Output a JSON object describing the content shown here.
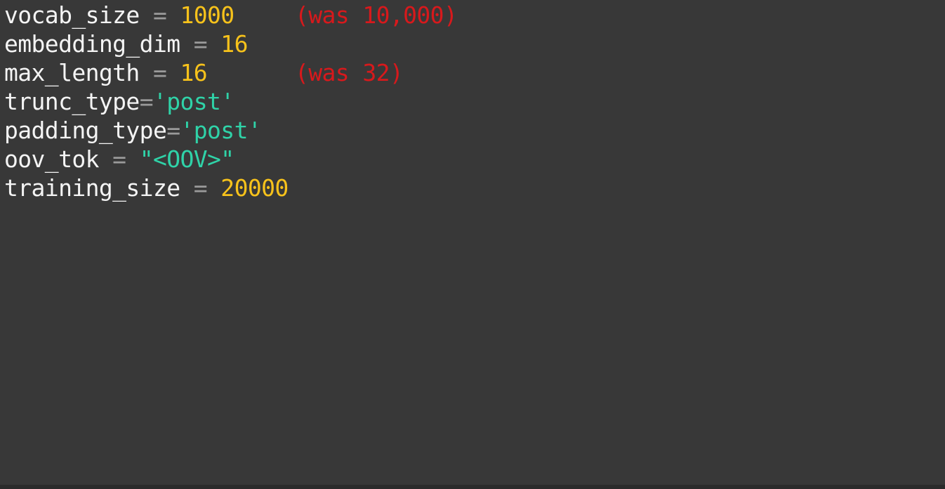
{
  "colors": {
    "background": "#383838",
    "identifier": "#f4f4f4",
    "operator": "#9a9a9a",
    "number": "#f7c21b",
    "string": "#2fd3a8",
    "annotation": "#d7191c"
  },
  "code_lines": [
    {
      "name": "vocab_size",
      "operator": " = ",
      "value": "1000",
      "annotation": "(was 10,000)"
    },
    {
      "name": "embedding_dim",
      "operator": " = ",
      "value": "16"
    },
    {
      "name": "max_length",
      "operator": " = ",
      "value": "16",
      "annotation": "(was 32)"
    },
    {
      "name": "trunc_type",
      "operator": "=",
      "value": "'post'"
    },
    {
      "name": "padding_type",
      "operator": "=",
      "value": "'post'"
    },
    {
      "name": "oov_tok",
      "operator": " = ",
      "value": "\"<OOV>\""
    },
    {
      "name": "training_size",
      "operator": " = ",
      "value": "20000"
    }
  ]
}
